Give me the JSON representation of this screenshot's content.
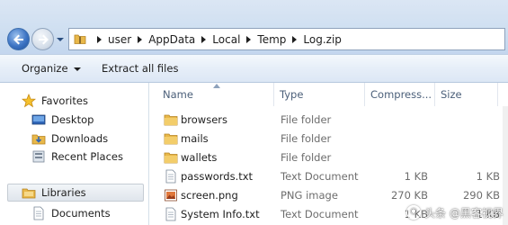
{
  "address": {
    "path": [
      "user",
      "AppData",
      "Local",
      "Temp",
      "Log.zip"
    ]
  },
  "toolbar": {
    "organize_label": "Organize",
    "extract_label": "Extract all files"
  },
  "navigation": {
    "favorites_label": "Favorites",
    "items": [
      {
        "label": "Desktop",
        "icon": "desktop-icon"
      },
      {
        "label": "Downloads",
        "icon": "downloads-icon"
      },
      {
        "label": "Recent Places",
        "icon": "recent-places-icon"
      }
    ],
    "libraries_label": "Libraries",
    "library_items": [
      {
        "label": "Documents",
        "icon": "documents-icon"
      }
    ]
  },
  "columns": {
    "name": "Name",
    "type": "Type",
    "compressed": "Compress...",
    "size": "Size"
  },
  "files": [
    {
      "name": "browsers",
      "type": "File folder",
      "compressed": "",
      "size": "",
      "icon": "folder-icon"
    },
    {
      "name": "mails",
      "type": "File folder",
      "compressed": "",
      "size": "",
      "icon": "folder-icon"
    },
    {
      "name": "wallets",
      "type": "File folder",
      "compressed": "",
      "size": "",
      "icon": "folder-icon"
    },
    {
      "name": "passwords.txt",
      "type": "Text Document",
      "compressed": "1 KB",
      "size": "1 KB",
      "icon": "text-file-icon"
    },
    {
      "name": "screen.png",
      "type": "PNG image",
      "compressed": "270 KB",
      "size": "290 KB",
      "icon": "image-file-icon"
    },
    {
      "name": "System Info.txt",
      "type": "Text Document",
      "compressed": "1 KB",
      "size": "1 KB",
      "icon": "text-file-icon"
    }
  ],
  "watermark": {
    "text": "头条 @黑客视界"
  },
  "colors": {
    "accent": "#3d74c4",
    "folder": "#e8b84a",
    "header_text": "#4c607a",
    "secondary_text": "#6d6d6d"
  }
}
